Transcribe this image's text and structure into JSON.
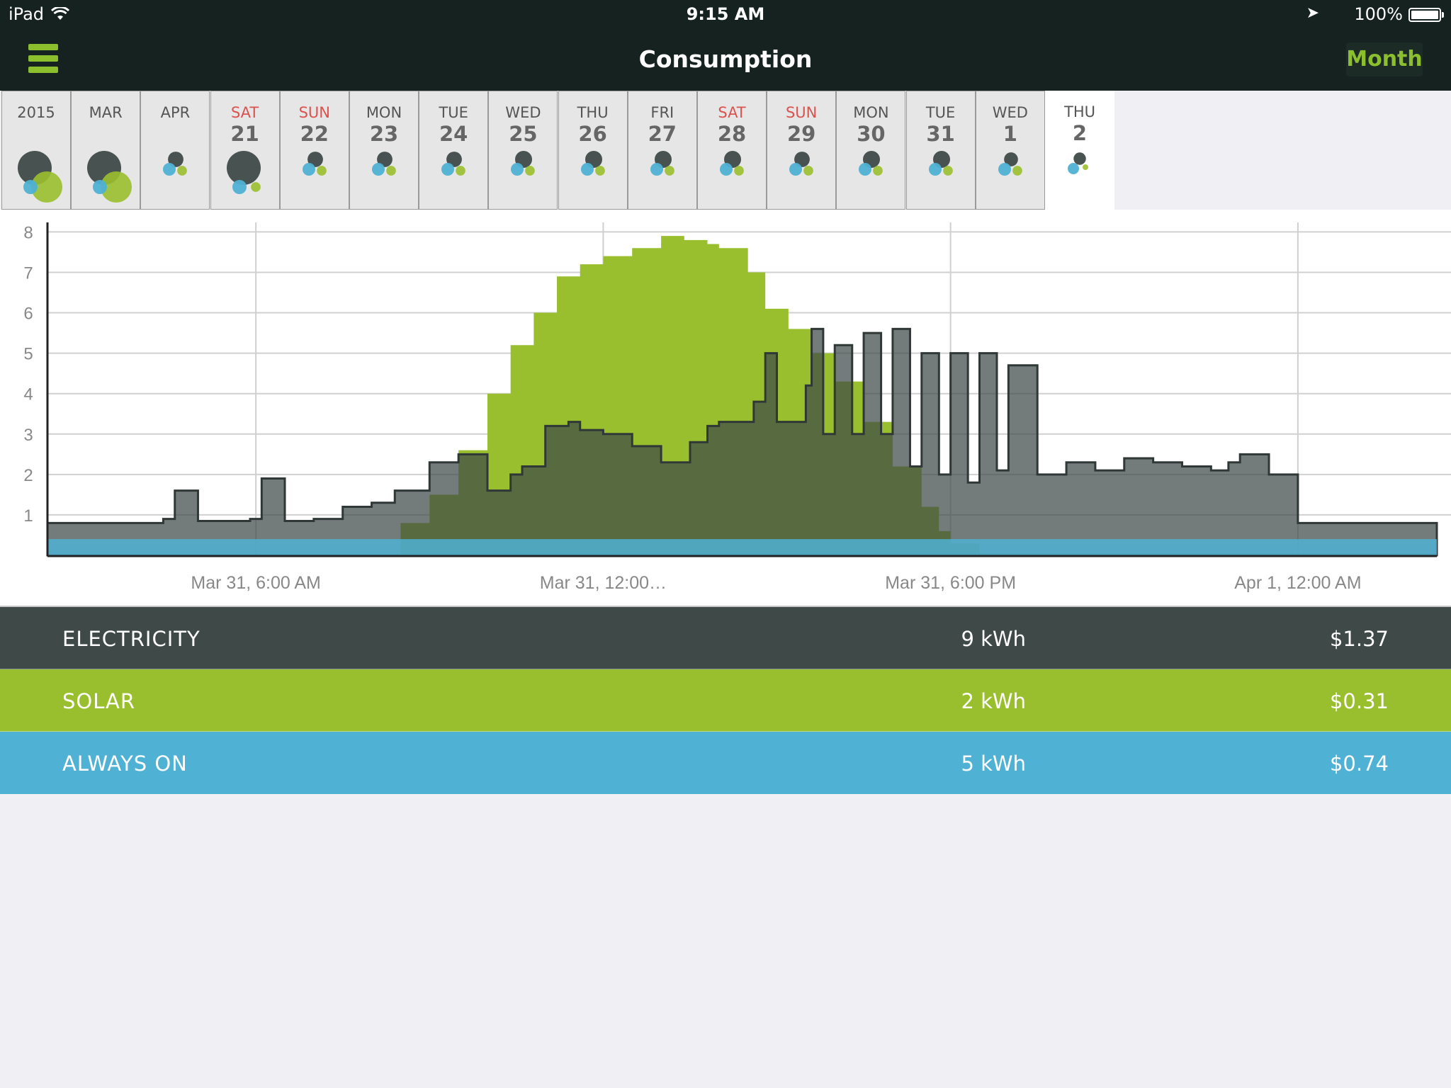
{
  "status_bar": {
    "carrier": "iPad",
    "time": "9:15 AM",
    "battery": "100%"
  },
  "nav": {
    "title": "Consumption",
    "period_button": "Month"
  },
  "colors": {
    "electricity": "#3f4a48",
    "solar": "#9abf2e",
    "always_on": "#4fb1d3",
    "weekend_text": "#d9534f"
  },
  "days": [
    {
      "label": "2015",
      "num": "",
      "weekend": false,
      "sizes": [
        1.0,
        0.45,
        1.0
      ]
    },
    {
      "label": "MAR",
      "num": "",
      "weekend": false,
      "sizes": [
        1.0,
        0.45,
        1.0
      ]
    },
    {
      "label": "APR",
      "num": "",
      "weekend": false,
      "sizes": [
        0.5,
        0.45,
        0.55
      ]
    },
    {
      "label": "SAT",
      "num": "21",
      "weekend": true,
      "sizes": [
        1.0,
        0.45,
        0.55
      ]
    },
    {
      "label": "SUN",
      "num": "22",
      "weekend": true,
      "sizes": [
        0.5,
        0.45,
        0.55
      ]
    },
    {
      "label": "MON",
      "num": "23",
      "weekend": false,
      "sizes": [
        0.5,
        0.45,
        0.55
      ]
    },
    {
      "label": "TUE",
      "num": "24",
      "weekend": false,
      "sizes": [
        0.5,
        0.45,
        0.55
      ]
    },
    {
      "label": "WED",
      "num": "25",
      "weekend": false,
      "sizes": [
        0.55,
        0.45,
        0.55
      ]
    },
    {
      "label": "THU",
      "num": "26",
      "weekend": false,
      "sizes": [
        0.55,
        0.45,
        0.55
      ]
    },
    {
      "label": "FRI",
      "num": "27",
      "weekend": false,
      "sizes": [
        0.55,
        0.45,
        0.55
      ]
    },
    {
      "label": "SAT",
      "num": "28",
      "weekend": true,
      "sizes": [
        0.55,
        0.45,
        0.55
      ]
    },
    {
      "label": "SUN",
      "num": "29",
      "weekend": true,
      "sizes": [
        0.5,
        0.45,
        0.55
      ]
    },
    {
      "label": "MON",
      "num": "30",
      "weekend": false,
      "sizes": [
        0.55,
        0.45,
        0.55
      ]
    },
    {
      "label": "TUE",
      "num": "31",
      "weekend": false,
      "sizes": [
        0.55,
        0.45,
        0.55
      ]
    },
    {
      "label": "WED",
      "num": "1",
      "weekend": false,
      "sizes": [
        0.45,
        0.45,
        0.55
      ]
    },
    {
      "label": "THU",
      "num": "2",
      "weekend": false,
      "sizes": [
        0.4,
        0.4,
        0.15
      ],
      "selected": true
    }
  ],
  "chart_data": {
    "type": "area",
    "ylim": [
      0,
      8.2
    ],
    "yticks": [
      1,
      2,
      3,
      4,
      5,
      6,
      7,
      8
    ],
    "x_tick_labels": [
      "Mar 31, 6:00 AM",
      "Mar 31, 12:00…",
      "Mar 31, 6:00 PM",
      "Apr 1, 12:00 AM"
    ],
    "x_tick_hours": [
      6,
      12,
      18,
      24
    ],
    "x_range_hours": [
      2.4,
      26.4
    ],
    "series": [
      {
        "name": "ELECTRICITY",
        "color": "#3f4a48",
        "x_hours": [
          2.4,
          3.5,
          4.4,
          4.6,
          5.0,
          5.9,
          6.1,
          6.5,
          7.0,
          7.5,
          8.0,
          8.4,
          8.6,
          9.0,
          9.5,
          10.0,
          10.4,
          10.6,
          11.0,
          11.4,
          11.6,
          12.0,
          12.5,
          13.0,
          13.5,
          13.8,
          14.0,
          14.6,
          14.8,
          15.0,
          15.5,
          15.6,
          15.8,
          16.0,
          16.3,
          16.5,
          16.8,
          17.0,
          17.3,
          17.5,
          17.8,
          18.0,
          18.3,
          18.5,
          18.8,
          19.0,
          19.5,
          20.0,
          20.5,
          21.0,
          21.5,
          22.0,
          22.5,
          22.8,
          23.0,
          23.5,
          24.0,
          25.0,
          26.4
        ],
        "values": [
          0.8,
          0.8,
          0.9,
          1.6,
          0.85,
          0.9,
          1.9,
          0.85,
          0.9,
          1.2,
          1.3,
          1.6,
          1.6,
          2.3,
          2.5,
          1.6,
          2.0,
          2.2,
          3.2,
          3.3,
          3.1,
          3.0,
          2.7,
          2.3,
          2.8,
          3.2,
          3.3,
          3.8,
          5.0,
          3.3,
          4.2,
          5.6,
          3.0,
          5.2,
          3.0,
          5.5,
          3.0,
          5.6,
          2.2,
          5.0,
          2.0,
          5.0,
          1.8,
          5.0,
          2.1,
          4.7,
          2.0,
          2.3,
          2.1,
          2.4,
          2.3,
          2.2,
          2.1,
          2.3,
          2.5,
          2.0,
          0.8,
          0.8,
          0.8
        ]
      },
      {
        "name": "SOLAR",
        "color": "#9abf2e",
        "x_hours": [
          2.4,
          7.0,
          8.5,
          9.0,
          9.5,
          10.0,
          10.4,
          10.8,
          11.2,
          11.6,
          12.0,
          12.5,
          13.0,
          13.4,
          13.8,
          14.0,
          14.5,
          14.8,
          15.2,
          15.6,
          16.0,
          16.5,
          17.0,
          17.5,
          17.8,
          18.0,
          18.5,
          26.4
        ],
        "values": [
          0,
          0,
          0.8,
          1.5,
          2.6,
          4.0,
          5.2,
          6.0,
          6.9,
          7.2,
          7.4,
          7.6,
          7.9,
          7.8,
          7.7,
          7.6,
          7.0,
          6.1,
          5.6,
          5.0,
          4.3,
          3.3,
          2.2,
          1.2,
          0.6,
          0.3,
          0.05,
          0
        ]
      },
      {
        "name": "ALWAYS ON",
        "color": "#4fb1d3",
        "x_hours": [
          2.4,
          26.4
        ],
        "values": [
          0.4,
          0.4
        ]
      }
    ]
  },
  "legend": [
    {
      "name": "ELECTRICITY",
      "kwh": "9 kWh",
      "cost": "$1.37"
    },
    {
      "name": "SOLAR",
      "kwh": "2 kWh",
      "cost": "$0.31"
    },
    {
      "name": "ALWAYS ON",
      "kwh": "5 kWh",
      "cost": "$0.74"
    }
  ]
}
